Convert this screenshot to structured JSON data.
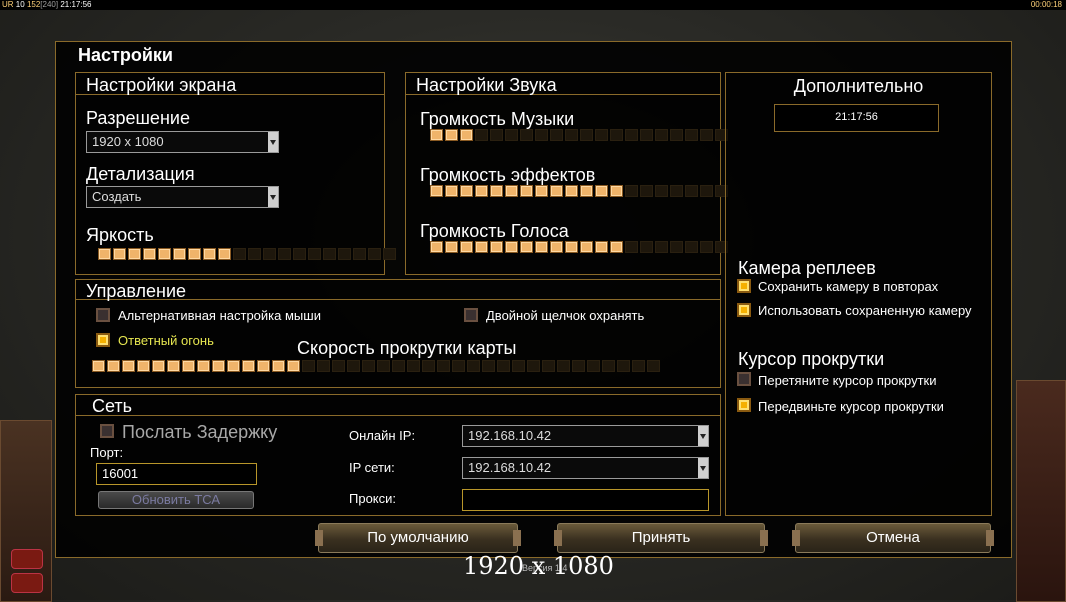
{
  "topbar": {
    "ur": "UR",
    "ur_val": "10",
    "fps": "152",
    "fps_bracket": "[240]",
    "clock": "21:17:56",
    "timer": "00:00:18"
  },
  "title": "Настройки",
  "screen": {
    "header": "Настройки экрана",
    "resolution_label": "Разрешение",
    "resolution_value": "1920 x 1080",
    "detail_label": "Детализация",
    "detail_value": "Создать",
    "brightness_label": "Яркость",
    "brightness_level": 9,
    "brightness_segments": 20
  },
  "sound": {
    "header": "Настройки Звука",
    "music_label": "Громкость Музыки",
    "music_level": 3,
    "effects_label": "Громкость эффектов",
    "effects_level": 13,
    "voice_label": "Громкость Голоса",
    "voice_level": 13,
    "segments": 20
  },
  "extra": {
    "header": "Дополнительно",
    "time": "21:17:56",
    "replay_camera_header": "Камера реплеев",
    "save_camera_label": "Сохранить камеру в повторах",
    "save_camera_checked": true,
    "use_saved_camera_label": "Использовать сохраненную камеру",
    "use_saved_camera_checked": true,
    "scroll_cursor_header": "Курсор прокрутки",
    "drag_cursor_label": "Перетяните курсор прокрутки",
    "drag_cursor_checked": false,
    "move_cursor_label": "Передвиньте курсор прокрутки",
    "move_cursor_checked": true
  },
  "controls": {
    "header": "Управление",
    "alt_mouse_label": "Альтернативная настройка мыши",
    "alt_mouse_checked": false,
    "double_click_label": "Двойной щелчок охранять",
    "double_click_checked": false,
    "return_fire_label": "Ответный огонь",
    "return_fire_checked": true,
    "scroll_speed_label": "Скорость прокрутки карты",
    "scroll_speed_level": 14,
    "scroll_speed_segments": 38
  },
  "network": {
    "header": "Сеть",
    "send_delay_label": "Послать Задержку",
    "send_delay_checked": false,
    "port_label": "Порт:",
    "port_value": "16001",
    "update_button": "Обновить ТСА",
    "online_ip_label": "Онлайн IP:",
    "online_ip_value": "192.168.10.42",
    "lan_ip_label": "IP сети:",
    "lan_ip_value": "192.168.10.42",
    "proxy_label": "Прокси:",
    "proxy_value": ""
  },
  "buttons": {
    "default": "По умолчанию",
    "accept": "Принять",
    "cancel": "Отмена"
  },
  "footer": {
    "resolution": "1920 x 1080",
    "version": "Версия 1.4"
  },
  "colors": {
    "accent": "#f0b46a",
    "border": "#8a6a2a",
    "return_fire_text": "#e6e650"
  }
}
